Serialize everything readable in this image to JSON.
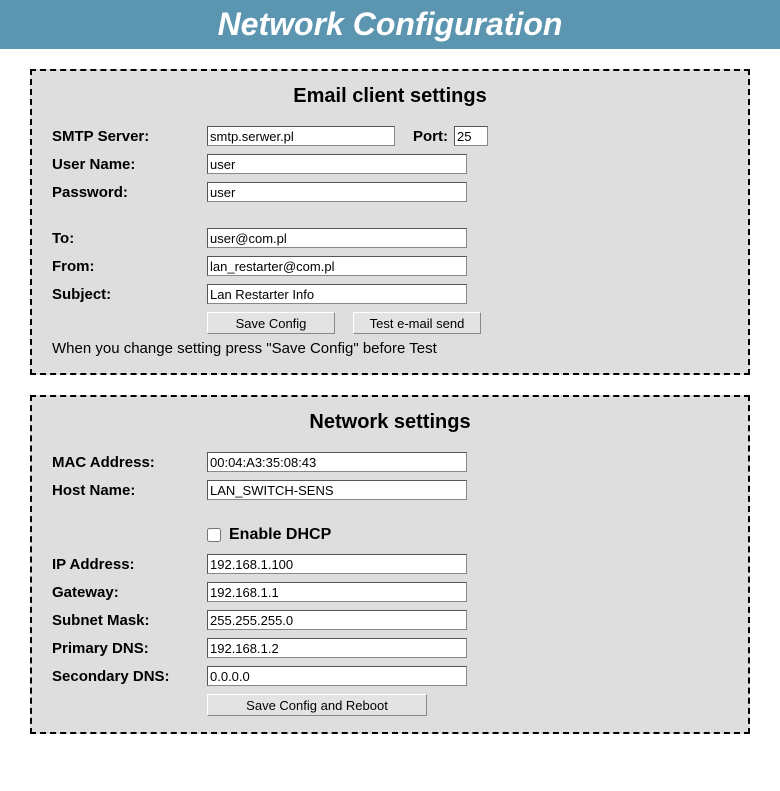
{
  "header": {
    "title": "Network Configuration"
  },
  "email": {
    "title": "Email client settings",
    "smtp_label": "SMTP Server:",
    "smtp_value": "smtp.serwer.pl",
    "port_label": "Port:",
    "port_value": "25",
    "user_label": "User Name:",
    "user_value": "user",
    "password_label": "Password:",
    "password_value": "user",
    "to_label": "To:",
    "to_value": "user@com.pl",
    "from_label": "From:",
    "from_value": "lan_restarter@com.pl",
    "subject_label": "Subject:",
    "subject_value": "Lan Restarter Info",
    "save_button": "Save Config",
    "test_button": "Test e-mail send",
    "note": "When you change setting press \"Save Config\" before Test"
  },
  "network": {
    "title": "Network settings",
    "mac_label": "MAC Address:",
    "mac_value": "00:04:A3:35:08:43",
    "host_label": "Host Name:",
    "host_value": "LAN_SWITCH-SENS",
    "dhcp_label": "Enable DHCP",
    "dhcp_checked": false,
    "ip_label": "IP Address:",
    "ip_value": "192.168.1.100",
    "gateway_label": "Gateway:",
    "gateway_value": "192.168.1.1",
    "subnet_label": "Subnet Mask:",
    "subnet_value": "255.255.255.0",
    "pdns_label": "Primary DNS:",
    "pdns_value": "192.168.1.2",
    "sdns_label": "Secondary DNS:",
    "sdns_value": "0.0.0.0",
    "save_reboot_button": "Save Config and Reboot"
  }
}
